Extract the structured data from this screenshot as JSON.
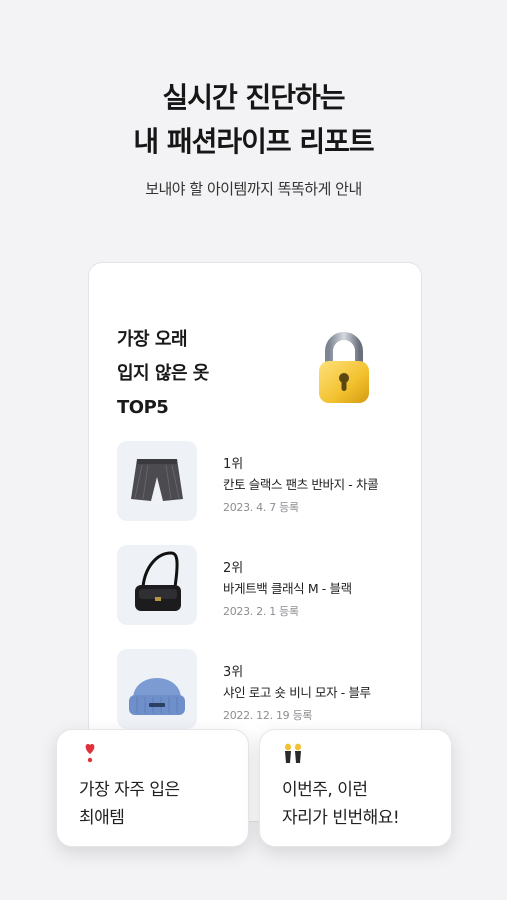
{
  "header": {
    "title_line1": "실시간 진단하는",
    "title_line2": "내 패션라이프 리포트",
    "subtitle": "보내야 할 아이템까지 똑똑하게 안내"
  },
  "card": {
    "title_line1": "가장 오래",
    "title_line2": "입지 않은 옷",
    "title_line3": "TOP5",
    "lock_icon": "lock-icon",
    "items": [
      {
        "rank": "1위",
        "name": "칸토 슬랙스 팬츠 반바지 - 차콜",
        "date": "2023. 4. 7 등록",
        "icon": "shorts-icon"
      },
      {
        "rank": "2위",
        "name": "바게트백 클래식 M - 블랙",
        "date": "2023. 2. 1 등록",
        "icon": "handbag-icon"
      },
      {
        "rank": "3위",
        "name": "샤인 로고 숏 비니 모자 - 블루",
        "date": "2022. 12. 19 등록",
        "icon": "beanie-icon"
      }
    ]
  },
  "popups": {
    "left": {
      "emoji": "heart-exclamation-icon",
      "line1": "가장 자주 입은",
      "line2": "최애템"
    },
    "right": {
      "emoji": "dancing-people-icon",
      "line1": "이번주, 이런",
      "line2": "자리가 빈번해요!"
    }
  },
  "colors": {
    "background": "#f3f3f5",
    "accent_gold": "#f2c12e",
    "heart": "#e0323a"
  }
}
